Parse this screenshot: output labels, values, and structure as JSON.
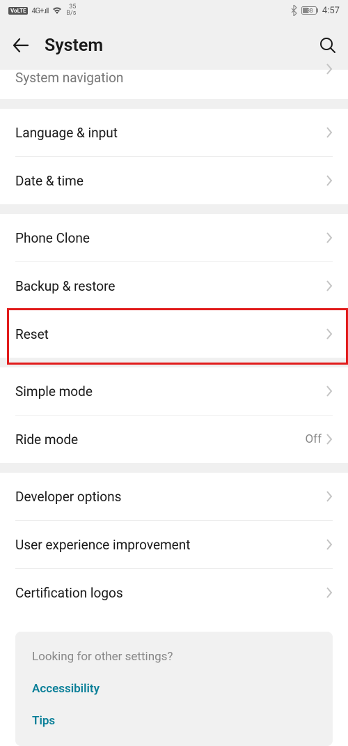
{
  "status": {
    "volte": "VoLTE",
    "signal_type": "4G+",
    "speed_num": "35",
    "speed_unit": "B/s",
    "battery": "38",
    "time": "4:57"
  },
  "header": {
    "title": "System"
  },
  "rows": {
    "system_navigation": "System navigation",
    "language_input": "Language & input",
    "date_time": "Date & time",
    "phone_clone": "Phone Clone",
    "backup_restore": "Backup & restore",
    "reset": "Reset",
    "simple_mode": "Simple mode",
    "ride_mode": "Ride mode",
    "ride_mode_value": "Off",
    "developer_options": "Developer options",
    "user_experience": "User experience improvement",
    "certification_logos": "Certification logos"
  },
  "footer": {
    "title": "Looking for other settings?",
    "accessibility": "Accessibility",
    "tips": "Tips"
  }
}
